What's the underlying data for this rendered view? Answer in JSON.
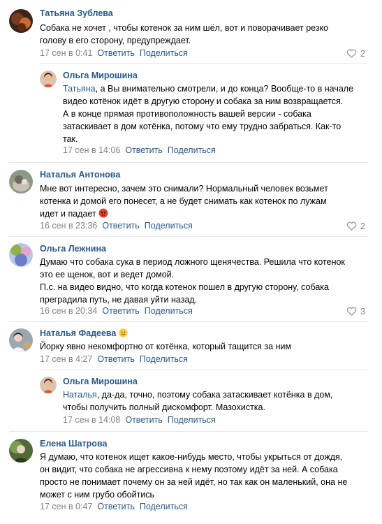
{
  "actions": {
    "reply": "Ответить",
    "share": "Поделиться"
  },
  "comments": [
    {
      "author": "Татьяна Зублева",
      "lines": [
        "Собака не хочет , чтобы котенок за ним шёл, вот и поворачивает резко",
        "голову в его сторону, предупреждает."
      ],
      "date": "17 сен в 0:41",
      "likes": "2"
    },
    {
      "author": "Ольга Мирошина",
      "mention": "Татьяна",
      "lines": [
        ", а Вы внимательно смотрели, и до конца? Вообще-то в начале",
        "видео котёнок идёт в другую сторону и собака за ним возвращается.",
        "А в конце прямая противоположность вашей версии - собака",
        "затаскивает в дом котёнка, потому что ему трудно забраться. Как-то",
        "так."
      ],
      "date": "17 сен в 14:06"
    },
    {
      "author": "Наталья Антонова",
      "lines": [
        "Мне вот интересно, зачем это снимали? Нормальный человек возьмет",
        "котенка и домой его понесет, а не будет снимать как котенок по лужам",
        "идет и падает"
      ],
      "date": "16 сен в 23:36",
      "likes": "2"
    },
    {
      "author": "Ольга Лежнина",
      "lines": [
        "Думаю что собака сука в период ложного щенячества. Решила что котенок",
        "это ее щенок, вот и ведет домой.",
        "П.с. на видео видно, что когда котенок пошел в другую сторону, собака",
        "преградила путь, не давая уйти назад."
      ],
      "date": "16 сен в 20:34",
      "likes": "3"
    },
    {
      "author": "Наталья Фадеева",
      "lines": [
        "Йорку явно некомфортно от котёнка, который тащится за ним"
      ],
      "date": "17 сен в 4:27"
    },
    {
      "author": "Ольга Мирошина",
      "mention": "Наталья",
      "lines": [
        ", да-да, точно, поэтому собака затаскивает котёнка в дом,",
        "чтобы получить полный дискомфорт. Мазохистка."
      ],
      "date": "17 сен в 14:08"
    },
    {
      "author": "Елена Шатрова",
      "lines": [
        "Я думаю, что котенок ищет какое-нибудь место, чтобы укрыться от дождя,",
        "он видит, что собака не агрессивна к нему поэтому идёт за ней. А собака",
        "просто не понимает почему он за ней идёт, но так как он маленький, она не",
        "может с ним грубо обойтись"
      ],
      "date": "17 сен в 0:47"
    }
  ],
  "icons": {
    "like": "heart-outline-icon",
    "angry_emoji": "angry-face-emoji-icon",
    "smile_emoji": "smile-emoji-icon"
  },
  "colors": {
    "link": "#2a5885",
    "meta": "#828282",
    "divider": "#e7e8ec"
  }
}
